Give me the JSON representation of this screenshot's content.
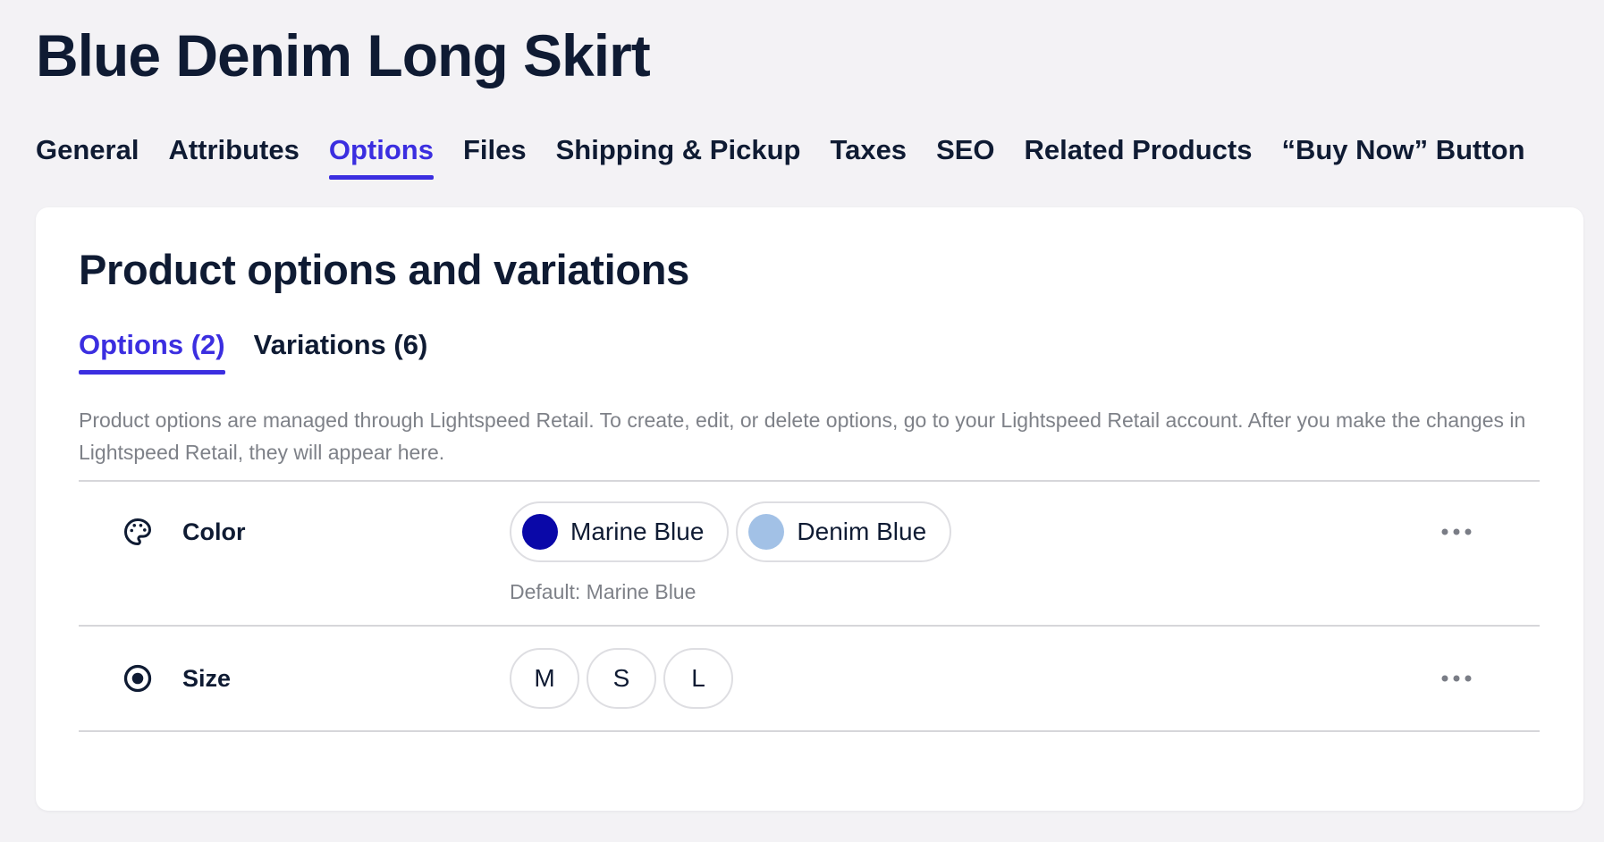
{
  "page": {
    "title": "Blue Denim Long Skirt"
  },
  "tabs": [
    {
      "label": "General",
      "active": false
    },
    {
      "label": "Attributes",
      "active": false
    },
    {
      "label": "Options",
      "active": true
    },
    {
      "label": "Files",
      "active": false
    },
    {
      "label": "Shipping & Pickup",
      "active": false
    },
    {
      "label": "Taxes",
      "active": false
    },
    {
      "label": "SEO",
      "active": false
    },
    {
      "label": "Related Products",
      "active": false
    },
    {
      "label": "“Buy Now” Button",
      "active": false
    }
  ],
  "section": {
    "title": "Product options and variations",
    "subtabs": [
      {
        "label": "Options (2)",
        "active": true
      },
      {
        "label": "Variations (6)",
        "active": false
      }
    ],
    "description": "Product options are managed through Lightspeed Retail. To create, edit, or delete options, go to your Lightspeed Retail account. After you make the changes in Lightspeed Retail, they will appear here.",
    "options": [
      {
        "name": "Color",
        "icon": "palette-icon",
        "values": [
          {
            "label": "Marine Blue",
            "swatch": "#0a08a8"
          },
          {
            "label": "Denim Blue",
            "swatch": "#a2c1e6"
          }
        ],
        "default_note": "Default: Marine Blue"
      },
      {
        "name": "Size",
        "icon": "radio-selected-icon",
        "values": [
          {
            "label": "M"
          },
          {
            "label": "S"
          },
          {
            "label": "L"
          }
        ]
      }
    ]
  },
  "colors": {
    "accent": "#3b2ee0",
    "text_primary": "#0f1b33",
    "text_muted": "#7e8188",
    "background": "#f3f2f5",
    "card": "#ffffff"
  }
}
